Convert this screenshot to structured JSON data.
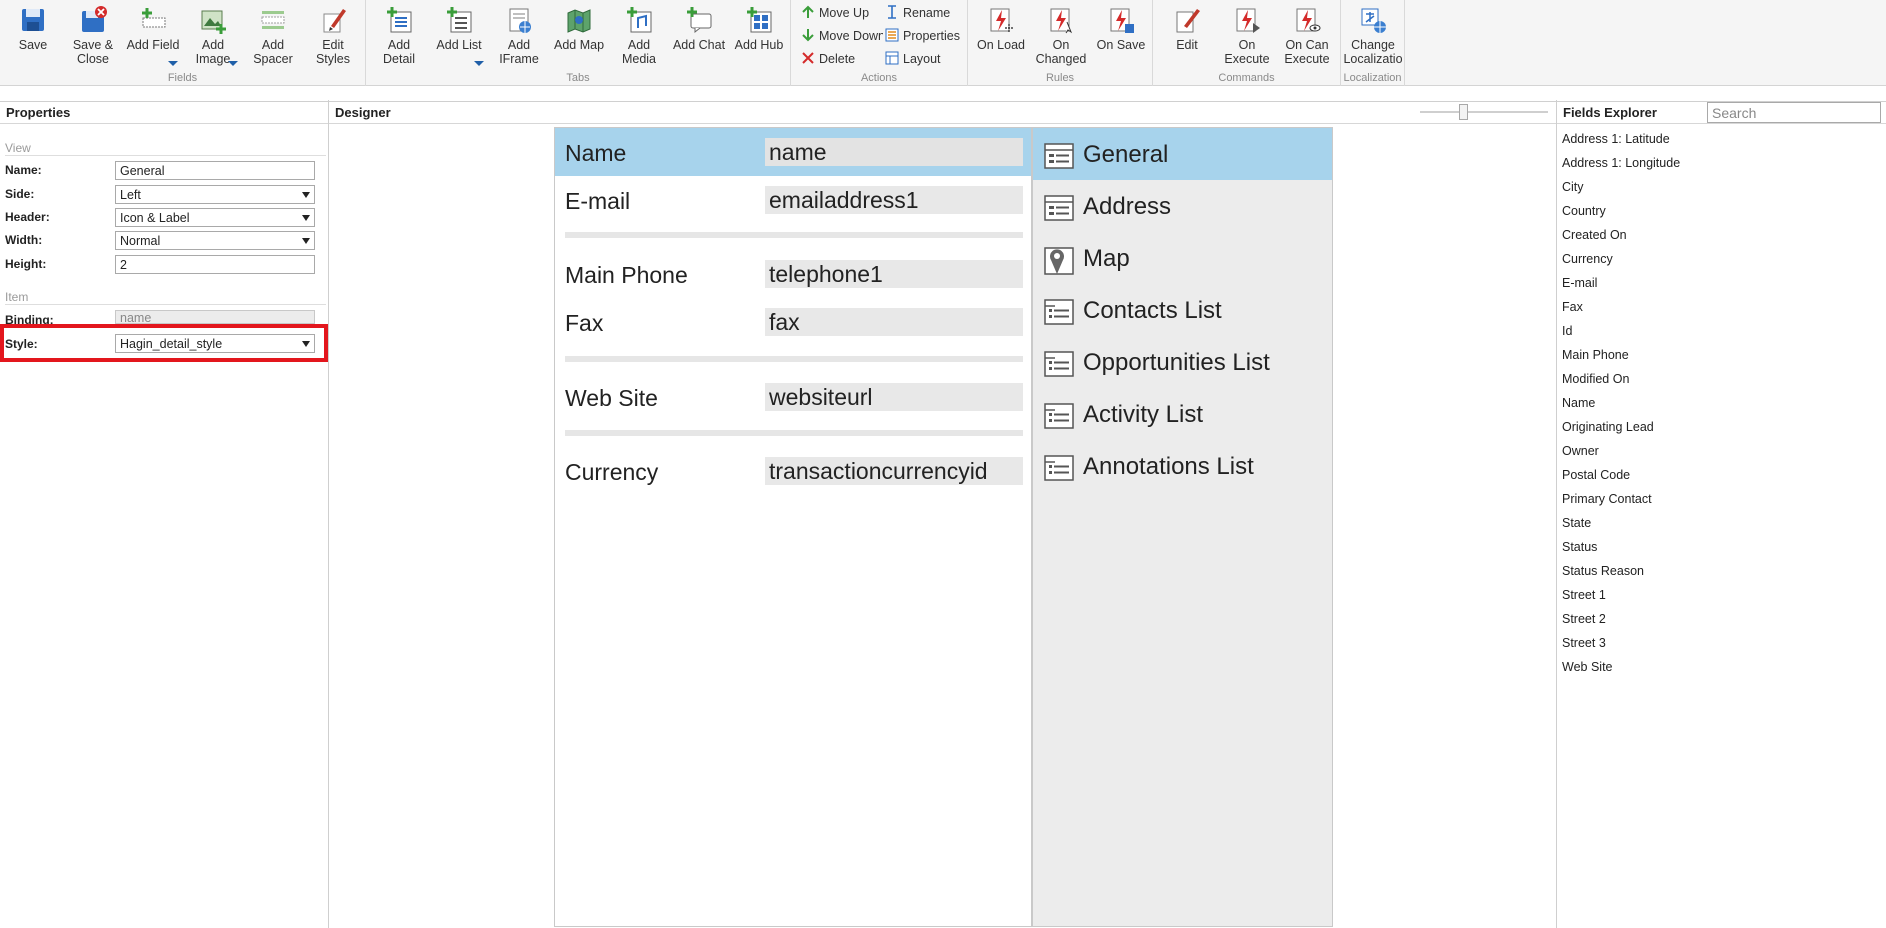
{
  "ribbon": {
    "groups": {
      "fields": "Fields",
      "tabs": "Tabs",
      "actions": "Actions",
      "rules": "Rules",
      "commands": "Commands",
      "localization": "Localization"
    },
    "buttons": {
      "save": "Save",
      "save_close": "Save &\nClose",
      "add_field": "Add Field",
      "add_image": "Add\nImage",
      "add_spacer": "Add\nSpacer",
      "edit_styles": "Edit\nStyles",
      "add_detail": "Add\nDetail",
      "add_list": "Add List",
      "add_iframe": "Add\nIFrame",
      "add_map": "Add Map",
      "add_media": "Add\nMedia",
      "add_chat": "Add Chat",
      "add_hub": "Add Hub",
      "move_up": "Move Up",
      "move_down": "Move Down",
      "delete": "Delete",
      "rename": "Rename",
      "properties": "Properties",
      "layout": "Layout",
      "on_load": "On Load",
      "on_changed": "On\nChanged",
      "on_save": "On Save",
      "edit": "Edit",
      "on_execute": "On\nExecute",
      "on_can_execute": "On Can\nExecute",
      "change_localization": "Change\nLocalizatio"
    }
  },
  "properties": {
    "header": "Properties",
    "view_section": "View",
    "item_section": "Item",
    "name_label": "Name:",
    "name_value": "General",
    "side_label": "Side:",
    "side_value": "Left",
    "header_label": "Header:",
    "header_value": "Icon & Label",
    "width_label": "Width:",
    "width_value": "Normal",
    "height_label": "Height:",
    "height_value": "2",
    "binding_label": "Binding:",
    "binding_value": "name",
    "style_label": "Style:",
    "style_value": "Hagin_detail_style"
  },
  "designer": {
    "header": "Designer",
    "fields": [
      {
        "label": "Name",
        "value": "name"
      },
      {
        "label": "E-mail",
        "value": "emailaddress1"
      },
      {
        "label": "Main Phone",
        "value": "telephone1"
      },
      {
        "label": "Fax",
        "value": "fax"
      },
      {
        "label": "Web Site",
        "value": "websiteurl"
      },
      {
        "label": "Currency",
        "value": "transactioncurrencyid"
      }
    ],
    "tabs": [
      {
        "label": "General",
        "icon": "detail-icon"
      },
      {
        "label": "Address",
        "icon": "detail-icon"
      },
      {
        "label": "Map",
        "icon": "map-pin-icon"
      },
      {
        "label": "Contacts List",
        "icon": "list-icon"
      },
      {
        "label": "Opportunities List",
        "icon": "list-icon"
      },
      {
        "label": "Activity List",
        "icon": "list-icon"
      },
      {
        "label": "Annotations List",
        "icon": "list-icon"
      }
    ]
  },
  "fields_explorer": {
    "header": "Fields Explorer",
    "search_placeholder": "Search",
    "items": [
      "Address 1: Latitude",
      "Address 1: Longitude",
      "City",
      "Country",
      "Created On",
      "Currency",
      "E-mail",
      "Fax",
      "Id",
      "Main Phone",
      "Modified On",
      "Name",
      "Originating Lead",
      "Owner",
      "Postal Code",
      "Primary Contact",
      "State",
      "Status",
      "Status Reason",
      "Street 1",
      "Street 2",
      "Street 3",
      "Web Site"
    ]
  },
  "colors": {
    "selection": "#a7d3ec",
    "highlight": "#e3161d",
    "accent_blue": "#1f5fa8",
    "accent_green": "#3a9d3a",
    "accent_red": "#d42b2b"
  }
}
